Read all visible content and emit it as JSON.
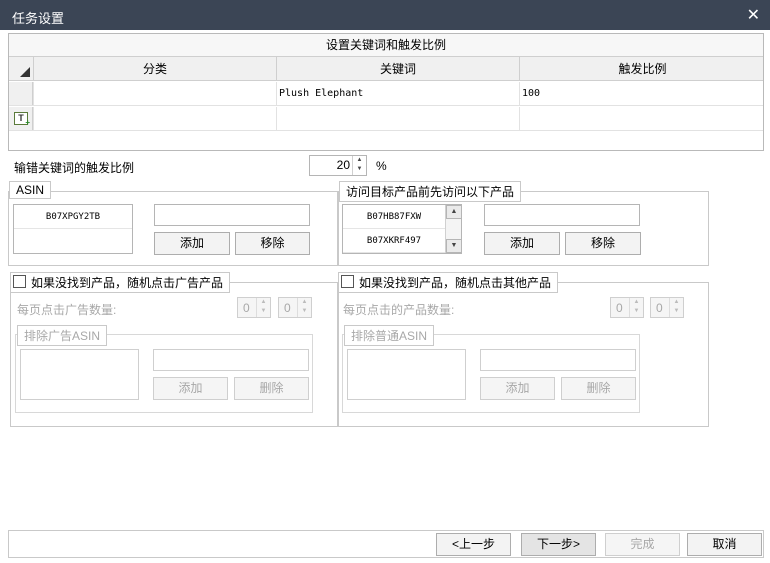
{
  "window": {
    "title": "任务设置",
    "close_glyph": "✕"
  },
  "grid": {
    "caption": "设置关键词和触发比例",
    "columns": [
      "分类",
      "关键词",
      "触发比例"
    ],
    "rows": [
      {
        "category": "",
        "keyword": "Plush Elephant",
        "ratio": "100"
      }
    ],
    "new_row_icon": "T"
  },
  "mistype": {
    "label": "输错关键词的触发比例",
    "value": "20",
    "unit": "%"
  },
  "asin": {
    "title": "ASIN",
    "items": [
      "B07XPGY2TB"
    ],
    "input_value": "",
    "add_label": "添加",
    "remove_label": "移除"
  },
  "prevvisit": {
    "title": "访问目标产品前先访问以下产品",
    "items": [
      "B07HB87FXW",
      "B07XKRF497"
    ],
    "input_value": "",
    "add_label": "添加",
    "remove_label": "移除"
  },
  "adclick": {
    "checkbox_label": "如果没找到产品，随机点击广告产品",
    "per_page_label": "每页点击广告数量:",
    "min": "0",
    "max": "0",
    "exclude_title": "排除广告ASIN",
    "add_label": "添加",
    "delete_label": "删除"
  },
  "otherclick": {
    "checkbox_label": "如果没找到产品，随机点击其他产品",
    "per_page_label": "每页点击的产品数量:",
    "min": "0",
    "max": "0",
    "exclude_title": "排除普通ASIN",
    "add_label": "添加",
    "delete_label": "删除"
  },
  "footer": {
    "prev": "<上一步",
    "next": "下一步>",
    "finish": "完成",
    "cancel": "取消"
  },
  "colors": {
    "titlebar": "#3b4555",
    "border": "#c9c9c9",
    "disabled_text": "#a8a8a8"
  }
}
